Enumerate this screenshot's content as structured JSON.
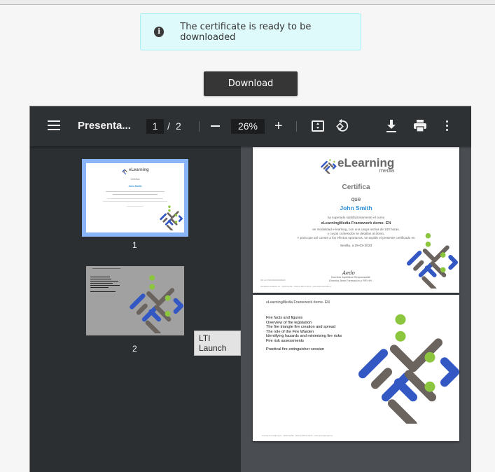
{
  "alert": {
    "icon": "info-icon",
    "message": "The certificate is ready to be downloaded"
  },
  "download_button": {
    "label": "Download"
  },
  "pdf_viewer": {
    "toolbar": {
      "menu_icon": "menu-icon",
      "title": "Presenta...",
      "current_page": "1",
      "page_separator": "/",
      "total_pages": "2",
      "zoom_out_icon": "minus-icon",
      "zoom_level": "26%",
      "zoom_in_icon": "+",
      "fit_icon": "fit-to-page-icon",
      "rotate_icon": "rotate-icon",
      "download_icon": "download-icon",
      "print_icon": "print-icon",
      "more_icon": "more-vert-icon"
    },
    "thumbnails": [
      {
        "label": "1",
        "selected": true
      },
      {
        "label": "2",
        "selected": false
      }
    ],
    "tooltip": "LTI Launch",
    "pages": {
      "page1": {
        "logo_word": "eLearning",
        "logo_sub": "media",
        "certifica": "Certifica",
        "que": "que",
        "name": "John Smith",
        "line1": "ha superado satisfactoriamente el curso",
        "course": "eLearningMedia Framework demo- EN",
        "line2": "en modalidad e-learning, con una carga lectiva de 100 horas,",
        "line3": "y cuyos contenidos se detallan al dorso.",
        "line4": "Y para que así conste a los efectos oportunos, se expide el presente certificado en",
        "date": "Sevilla, a   29-03-2023",
        "signature": "Aedo",
        "responsible": "Nombre Apellidos Responsable",
        "director": "Director Área Formación y RR.HH.",
        "code": "### ref.27###1890###f###8d##",
        "footer": "Avenida de Andalucía s/n · 41000 Sevilla · Teléfono 955 00 00 00 · www.elearningmedia.es"
      },
      "page2": {
        "header": "eLearningMedia Framework demo- EN",
        "topics": [
          "Fire facts and figures",
          "Overview of fire legislation",
          "The fire triangle  fire creation and spread",
          "The role of the Fire Warden",
          "Identifying hazards and minimising fire risks",
          "Fire risk assessments"
        ],
        "extra": "Practical fire extinguisher session",
        "footer": "Avenida de Andalucía s/n · 41000 Sevilla · Teléfono 955 00 00 00 · www.elearningmedia.es"
      }
    }
  },
  "colors": {
    "brand_blue": "#3358c4",
    "brand_gray": "#6b635d",
    "brand_green": "#8cc63f",
    "name_blue": "#2a8fd6",
    "thumb_selected": "#8ab4f8",
    "alert_bg": "#dffafb"
  }
}
